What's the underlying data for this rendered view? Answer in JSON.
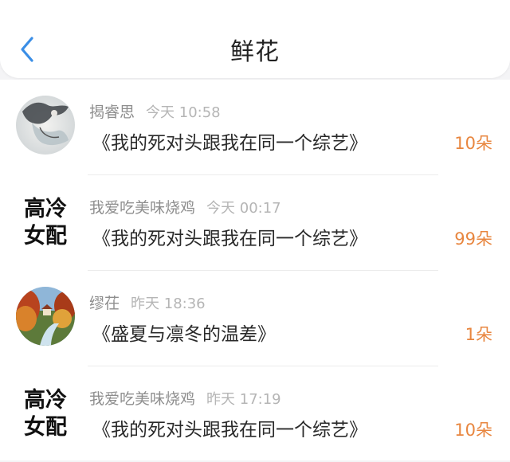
{
  "header": {
    "title": "鲜花",
    "back_icon": "chevron-left-icon",
    "accent_color": "#3a8ee6"
  },
  "items": [
    {
      "avatar_type": "image",
      "avatar_desc": "ink-wash-figure",
      "user": "揭睿思",
      "time": "今天 10:58",
      "book": "《我的死对头跟我在同一个综艺》",
      "count": "10朵"
    },
    {
      "avatar_type": "text",
      "avatar_text_line1": "高冷",
      "avatar_text_line2": "女配",
      "user": "我爱吃美味烧鸡",
      "time": "今天 00:17",
      "book": "《我的死对头跟我在同一个综艺》",
      "count": "99朵"
    },
    {
      "avatar_type": "image",
      "avatar_desc": "autumn-landscape",
      "user": "缪茌",
      "time": "昨天 18:36",
      "book": "《盛夏与凛冬的温差》",
      "count": "1朵"
    },
    {
      "avatar_type": "text",
      "avatar_text_line1": "高冷",
      "avatar_text_line2": "女配",
      "user": "我爱吃美味烧鸡",
      "time": "昨天 17:19",
      "book": "《我的死对头跟我在同一个综艺》",
      "count": "10朵"
    }
  ],
  "colors": {
    "count": "#e8863f",
    "meta": "#8e8e8e"
  }
}
